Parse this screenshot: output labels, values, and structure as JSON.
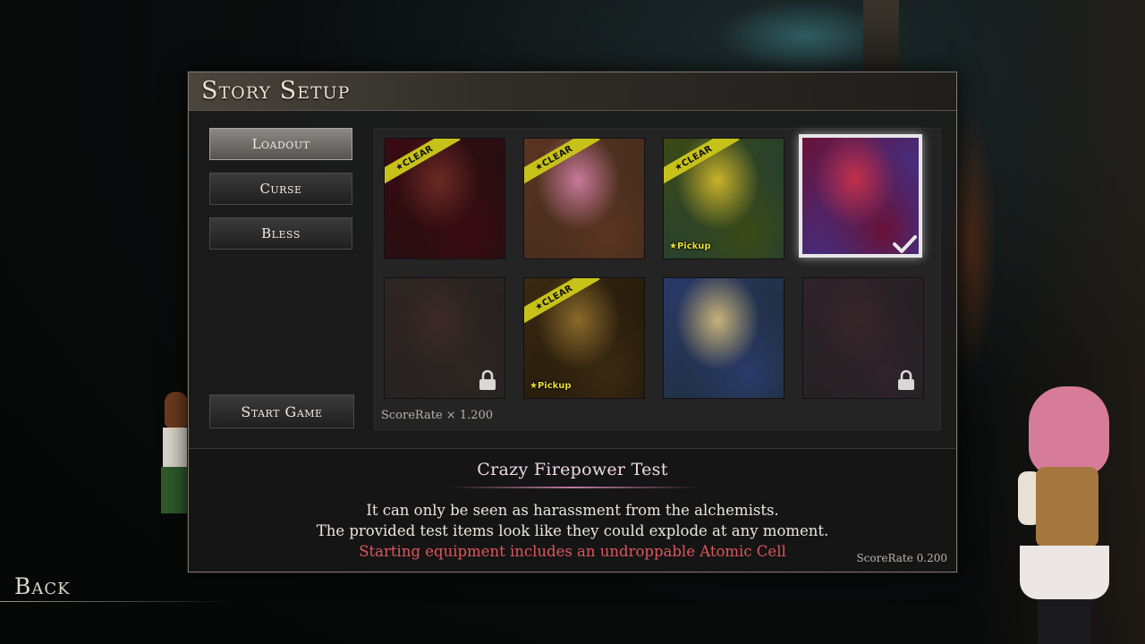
{
  "header": {
    "title": "Story Setup"
  },
  "menu": {
    "loadout": "Loadout",
    "curse": "Curse",
    "bless": "Bless",
    "start_game": "Start Game"
  },
  "cards": [
    {
      "clear": true,
      "pickup": false,
      "locked": false,
      "selected": false,
      "colors": [
        "#3a0a12",
        "#6b2a24",
        "#1a1210"
      ]
    },
    {
      "clear": true,
      "pickup": false,
      "locked": false,
      "selected": false,
      "colors": [
        "#5a3420",
        "#c8799a",
        "#3b2a1c"
      ]
    },
    {
      "clear": true,
      "pickup": true,
      "locked": false,
      "selected": false,
      "colors": [
        "#3b4a14",
        "#c9b22a",
        "#1a3a40"
      ]
    },
    {
      "clear": false,
      "pickup": false,
      "locked": false,
      "selected": true,
      "colors": [
        "#6a1236",
        "#c2304a",
        "#2b3fae"
      ]
    },
    {
      "clear": false,
      "pickup": false,
      "locked": true,
      "selected": false,
      "colors": [
        "#4a2a22",
        "#7a3a32",
        "#1e1614"
      ]
    },
    {
      "clear": true,
      "pickup": true,
      "locked": false,
      "selected": false,
      "colors": [
        "#3a2a12",
        "#8a6a2a",
        "#1a1208"
      ]
    },
    {
      "clear": false,
      "pickup": false,
      "locked": false,
      "selected": false,
      "colors": [
        "#2a3a6a",
        "#c8b27a",
        "#1a2a2a"
      ]
    },
    {
      "clear": false,
      "pickup": false,
      "locked": true,
      "selected": false,
      "colors": [
        "#4a2236",
        "#6a2a3a",
        "#1a1418"
      ]
    }
  ],
  "labels": {
    "clear": "★CLEAR",
    "pickup": "★Pickup"
  },
  "grid_scorerate": "ScoreRate × 1.200",
  "description": {
    "title": "Crazy Firepower Test",
    "line1": "It can only be seen as harassment from the alchemists.",
    "line2": "The provided test items look like they could explode at any moment.",
    "line3": "Starting equipment includes an undroppable Atomic Cell",
    "scorerate": "ScoreRate  0.200"
  },
  "back_label": "Back",
  "icons": {
    "lock": "lock-icon",
    "check": "check-icon"
  },
  "colors": {
    "warning": "#e0565e",
    "clear_ribbon": "#c7c21a",
    "title_pink": "#f1d8e4"
  }
}
